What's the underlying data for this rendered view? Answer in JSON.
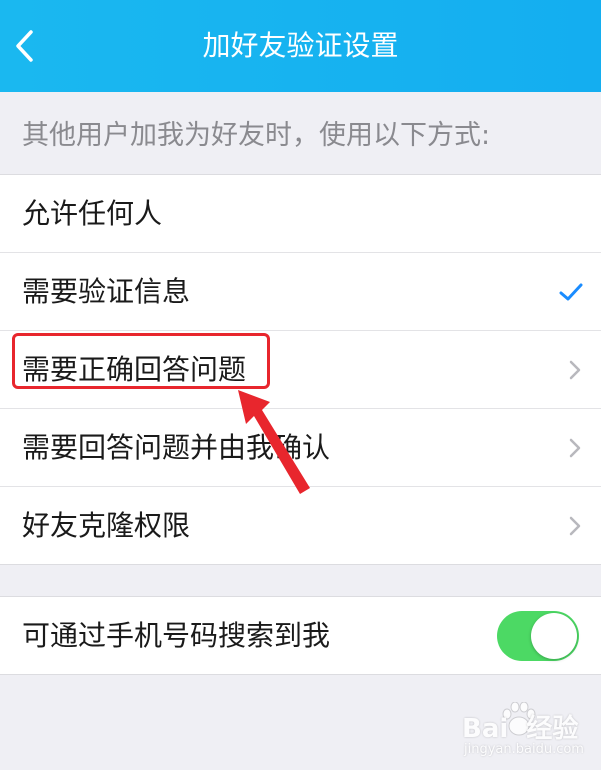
{
  "header": {
    "title": "加好友验证设置"
  },
  "section_hint": "其他用户加我为好友时，使用以下方式:",
  "options": [
    {
      "label": "允许任何人",
      "control": "none"
    },
    {
      "label": "需要验证信息",
      "control": "check"
    },
    {
      "label": "需要正确回答问题",
      "control": "chevron"
    },
    {
      "label": "需要回答问题并由我确认",
      "control": "chevron"
    },
    {
      "label": "好友克隆权限",
      "control": "chevron"
    }
  ],
  "phone_search": {
    "label": "可通过手机号码搜索到我",
    "enabled": true
  },
  "watermark": {
    "brand": "Bai  经验",
    "url": "jingyan.baidu.com"
  },
  "colors": {
    "header_bg": "#14aef0",
    "check": "#1a8cff",
    "toggle_on": "#4cd964",
    "annotation_red": "#e8262d"
  }
}
